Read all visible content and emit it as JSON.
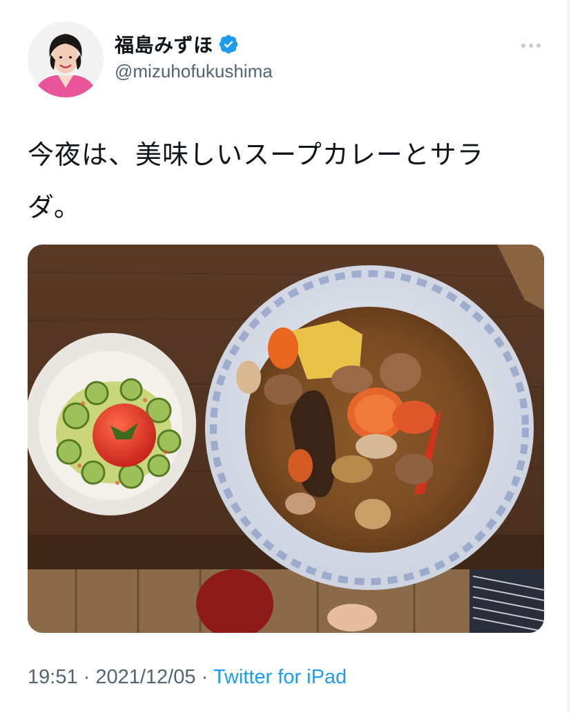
{
  "author": {
    "display_name": "福島みずほ",
    "handle": "@mizuhofukushima",
    "verified": true,
    "avatar_icon": "profile-avatar"
  },
  "more_icon": "more-horizontal-icon",
  "tweet": {
    "text_line1": "今夜は、美味しいスープカレーとサラ",
    "text_line2": "ダ。"
  },
  "media": {
    "icon": "photo-soup-curry-and-salad"
  },
  "meta": {
    "time": "19:51",
    "separator1": " · ",
    "date": "2021/12/05",
    "separator2": " · ",
    "source": "Twitter for iPad"
  },
  "colors": {
    "text": "#0f1419",
    "secondary": "#536471",
    "accent": "#1d9bf0"
  }
}
